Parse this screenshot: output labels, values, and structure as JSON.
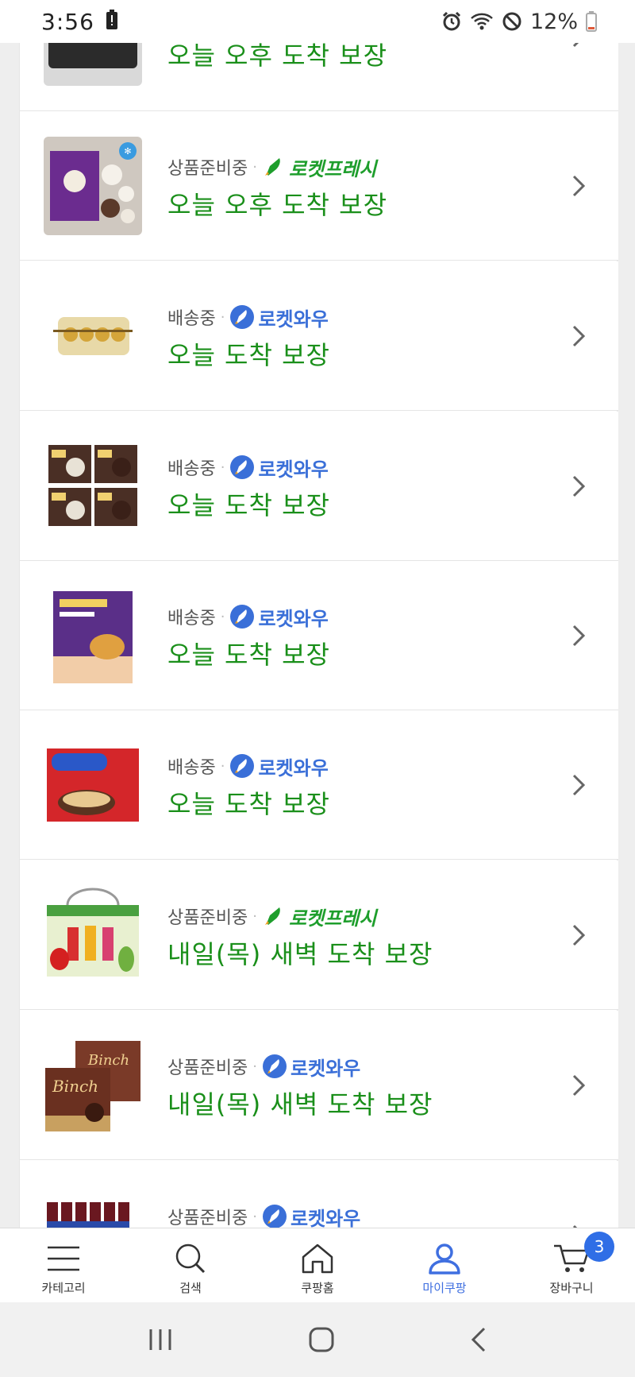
{
  "status_bar": {
    "time": "3:56",
    "battery": "12%"
  },
  "orders": [
    {
      "status": "",
      "badge_type": "",
      "badge_text": "",
      "arrival": "오늘 오후 도착 보장",
      "thumb": "snack-box"
    },
    {
      "status": "상품준비중",
      "badge_type": "fresh",
      "badge_text": "로켓프레시",
      "arrival": "오늘 오후 도착 보장",
      "thumb": "rice-cake-box"
    },
    {
      "status": "배송중",
      "badge_type": "wow",
      "badge_text": "로켓와우",
      "arrival": "오늘 도착 보장",
      "thumb": "gold-chocolate-box"
    },
    {
      "status": "배송중",
      "badge_type": "wow",
      "badge_text": "로켓와우",
      "arrival": "오늘 도착 보장",
      "thumb": "cake-four-pack"
    },
    {
      "status": "배송중",
      "badge_type": "wow",
      "badge_text": "로켓와우",
      "arrival": "오늘 도착 보장",
      "thumb": "purple-snack-box"
    },
    {
      "status": "배송중",
      "badge_type": "wow",
      "badge_text": "로켓와우",
      "arrival": "오늘 도착 보장",
      "thumb": "red-pie-box"
    },
    {
      "status": "상품준비중",
      "badge_type": "fresh",
      "badge_text": "로켓프레시",
      "arrival": "내일(목) 새벽 도착 보장",
      "thumb": "juice-gift-box"
    },
    {
      "status": "상품준비중",
      "badge_type": "wow",
      "badge_text": "로켓와우",
      "arrival": "내일(목) 새벽 도착 보장",
      "thumb": "binch-box"
    },
    {
      "status": "상품준비중",
      "badge_type": "wow",
      "badge_text": "로켓와우",
      "arrival": "",
      "thumb": "soda-bottles"
    }
  ],
  "bottom_nav": [
    {
      "label": "카테고리",
      "icon": "menu-icon",
      "active": false
    },
    {
      "label": "검색",
      "icon": "search-icon",
      "active": false
    },
    {
      "label": "쿠팡홈",
      "icon": "home-icon",
      "active": false
    },
    {
      "label": "마이쿠팡",
      "icon": "person-icon",
      "active": true
    },
    {
      "label": "장바구니",
      "icon": "cart-icon",
      "active": false
    }
  ],
  "cart_count": "3",
  "colors": {
    "arrival_green": "#1a8f1a",
    "fresh_green": "#1e9e2c",
    "wow_blue": "#3a6fd8",
    "active_nav": "#3f6fe0",
    "cart_badge": "#2f6ee6"
  }
}
